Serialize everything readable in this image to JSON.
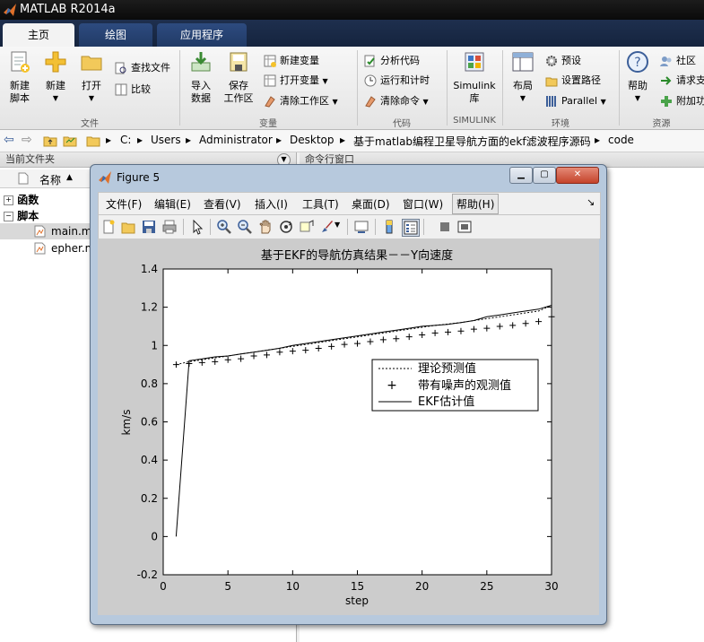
{
  "app": {
    "title": "MATLAB R2014a"
  },
  "tabs": [
    {
      "label": "主页",
      "active": true
    },
    {
      "label": "绘图",
      "active": false
    },
    {
      "label": "应用程序",
      "active": false
    }
  ],
  "ribbon": {
    "file": {
      "group": "文件",
      "new_script": "新建\n脚本",
      "new": "新建",
      "open": "打开",
      "find_files": "查找文件",
      "compare": "比较"
    },
    "variable": {
      "group": "变量",
      "import": "导入\n数据",
      "save": "保存\n工作区",
      "new_var": "新建变量",
      "open_var": "打开变量",
      "clear_ws": "清除工作区"
    },
    "code": {
      "group": "代码",
      "analyze": "分析代码",
      "run_time": "运行和计时",
      "clear_cmd": "清除命令"
    },
    "simulink": {
      "group": "SIMULINK",
      "label": "Simulink\n库"
    },
    "env": {
      "group": "环境",
      "layout": "布局",
      "prefs": "预设",
      "set_path": "设置路径",
      "parallel": "Parallel"
    },
    "resources": {
      "group": "资源",
      "help": "帮助",
      "community": "社区",
      "request": "请求支",
      "addons": "附加功"
    }
  },
  "address": {
    "crumbs": [
      "C:",
      "Users",
      "Administrator",
      "Desktop",
      "基于matlab编程卫星导航方面的ekf滤波程序源码",
      "code"
    ]
  },
  "current_folder": {
    "title": "当前文件夹",
    "col_name": "名称",
    "sort_arrow": "▲",
    "groups": [
      {
        "label": "函数",
        "expander": "+"
      },
      {
        "label": "脚本",
        "expander": "−"
      }
    ],
    "files": [
      "main.m",
      "epher.m"
    ]
  },
  "command_window": {
    "title": "命令行窗口"
  },
  "figure": {
    "title": "Figure 5",
    "menu": [
      "文件(F)",
      "编辑(E)",
      "查看(V)",
      "插入(I)",
      "工具(T)",
      "桌面(D)",
      "窗口(W)",
      "帮助(H)"
    ],
    "menu_more": "↘"
  },
  "chart_data": {
    "type": "line",
    "title": "基于EKF的导航仿真结果－－Y向速度",
    "xlabel": "step",
    "ylabel": "km/s",
    "xlim": [
      0,
      30
    ],
    "ylim": [
      -0.2,
      1.4
    ],
    "xticks": [
      0,
      5,
      10,
      15,
      20,
      25,
      30
    ],
    "yticks": [
      -0.2,
      0,
      0.2,
      0.4,
      0.6,
      0.8,
      1,
      1.2,
      1.4
    ],
    "grid": false,
    "legend_position": "right",
    "series": [
      {
        "name": "理论预测值",
        "style": "dotted",
        "x": [
          1,
          2,
          3,
          4,
          5,
          6,
          7,
          8,
          9,
          10,
          11,
          12,
          13,
          14,
          15,
          16,
          17,
          18,
          19,
          20,
          21,
          22,
          23,
          24,
          25,
          26,
          27,
          28,
          29,
          30
        ],
        "y": [
          0.9,
          0.915,
          0.925,
          0.935,
          0.945,
          0.955,
          0.965,
          0.975,
          0.985,
          0.995,
          1.005,
          1.015,
          1.025,
          1.035,
          1.045,
          1.055,
          1.065,
          1.075,
          1.085,
          1.095,
          1.105,
          1.112,
          1.12,
          1.13,
          1.14,
          1.15,
          1.16,
          1.17,
          1.18,
          1.21
        ]
      },
      {
        "name": "带有噪声的观测值",
        "style": "plus",
        "x": [
          1,
          2,
          3,
          4,
          5,
          6,
          7,
          8,
          9,
          10,
          11,
          12,
          13,
          14,
          15,
          16,
          17,
          18,
          19,
          20,
          21,
          22,
          23,
          24,
          25,
          26,
          27,
          28,
          29,
          30
        ],
        "y": [
          0.9,
          0.905,
          0.91,
          0.915,
          0.925,
          0.93,
          0.945,
          0.95,
          0.965,
          0.97,
          0.975,
          0.985,
          0.995,
          1.005,
          1.01,
          1.02,
          1.03,
          1.035,
          1.045,
          1.055,
          1.065,
          1.07,
          1.075,
          1.085,
          1.09,
          1.1,
          1.105,
          1.115,
          1.125,
          1.15
        ]
      },
      {
        "name": "EKF估计值",
        "style": "solid",
        "x": [
          1,
          2,
          3,
          4,
          5,
          6,
          7,
          8,
          9,
          10,
          11,
          12,
          13,
          14,
          15,
          16,
          17,
          18,
          19,
          20,
          21,
          22,
          23,
          24,
          25,
          26,
          27,
          28,
          29,
          30
        ],
        "y": [
          0.0,
          0.92,
          0.93,
          0.94,
          0.945,
          0.955,
          0.965,
          0.975,
          0.985,
          1.0,
          1.01,
          1.02,
          1.03,
          1.04,
          1.05,
          1.06,
          1.07,
          1.08,
          1.09,
          1.1,
          1.105,
          1.11,
          1.12,
          1.13,
          1.15,
          1.16,
          1.17,
          1.18,
          1.19,
          1.21
        ]
      }
    ]
  }
}
